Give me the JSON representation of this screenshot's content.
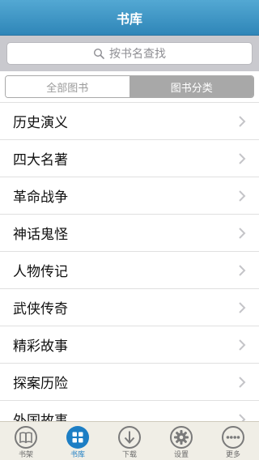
{
  "navbar": {
    "title": "书库"
  },
  "search": {
    "placeholder": "按书名查找"
  },
  "segments": [
    {
      "label": "全部图书",
      "selected": false
    },
    {
      "label": "图书分类",
      "selected": true
    }
  ],
  "categories": [
    {
      "label": "历史演义"
    },
    {
      "label": "四大名著"
    },
    {
      "label": "革命战争"
    },
    {
      "label": "神话鬼怪"
    },
    {
      "label": "人物传记"
    },
    {
      "label": "武侠传奇"
    },
    {
      "label": "精彩故事"
    },
    {
      "label": "探案历险"
    },
    {
      "label": "外国故事"
    }
  ],
  "tabbar": {
    "active_index": 1,
    "items": [
      {
        "label": "书架",
        "icon": "book-icon"
      },
      {
        "label": "书库",
        "icon": "grid-icon"
      },
      {
        "label": "下载",
        "icon": "download-icon"
      },
      {
        "label": "设置",
        "icon": "gear-icon"
      },
      {
        "label": "更多",
        "icon": "more-icon"
      }
    ]
  },
  "colors": {
    "navbar": "#2f86b8",
    "active_tab": "#1d7ec4",
    "inactive_tab": "#6b6b6b",
    "tabbar_bg": "#f0eee6"
  }
}
